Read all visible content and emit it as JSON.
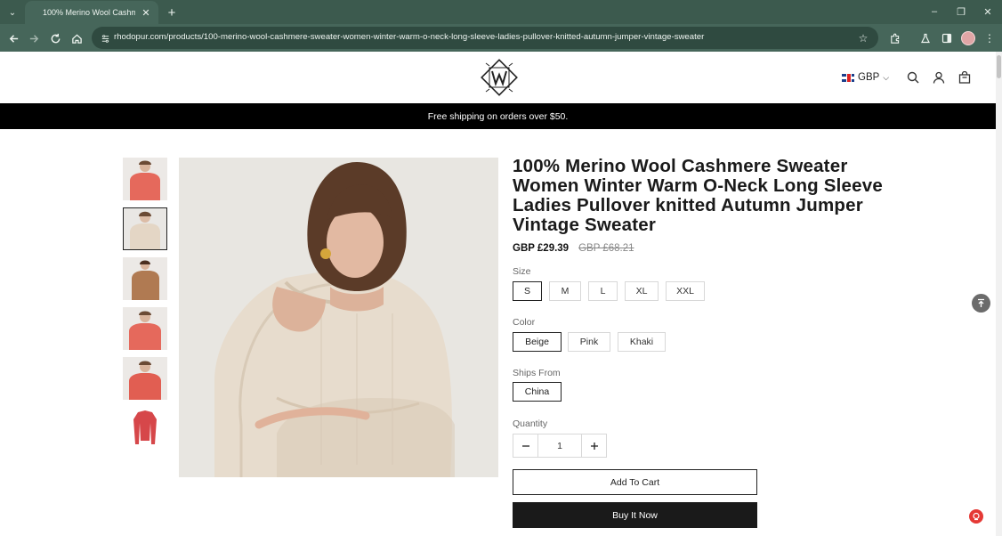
{
  "browser": {
    "tab_title": "100% Merino Wool Cashmere Sweater Women Winter Warm O-Neck Long Sleeve",
    "url": "rhodopur.com/products/100-merino-wool-cashmere-sweater-women-winter-warm-o-neck-long-sleeve-ladies-pullover-knitted-autumn-jumper-vintage-sweater",
    "accent_color": "#46665a"
  },
  "header": {
    "currency": "GBP"
  },
  "announcement": "Free shipping on orders over $50.",
  "product": {
    "title": "100% Merino Wool Cashmere Sweater Women Winter Warm O-Neck Long Sleeve Ladies Pullover knitted Autumn Jumper Vintage Sweater",
    "price": "GBP £29.39",
    "compare_price": "GBP £68.21",
    "size_label": "Size",
    "sizes": [
      "S",
      "M",
      "L",
      "XL",
      "XXL"
    ],
    "selected_size": "S",
    "color_label": "Color",
    "colors": [
      "Beige",
      "Pink",
      "Khaki"
    ],
    "selected_color": "Beige",
    "ships_label": "Ships From",
    "ships_from": [
      "China"
    ],
    "quantity_label": "Quantity",
    "quantity": "1",
    "add_to_cart": "Add To Cart",
    "buy_now": "Buy It Now"
  }
}
